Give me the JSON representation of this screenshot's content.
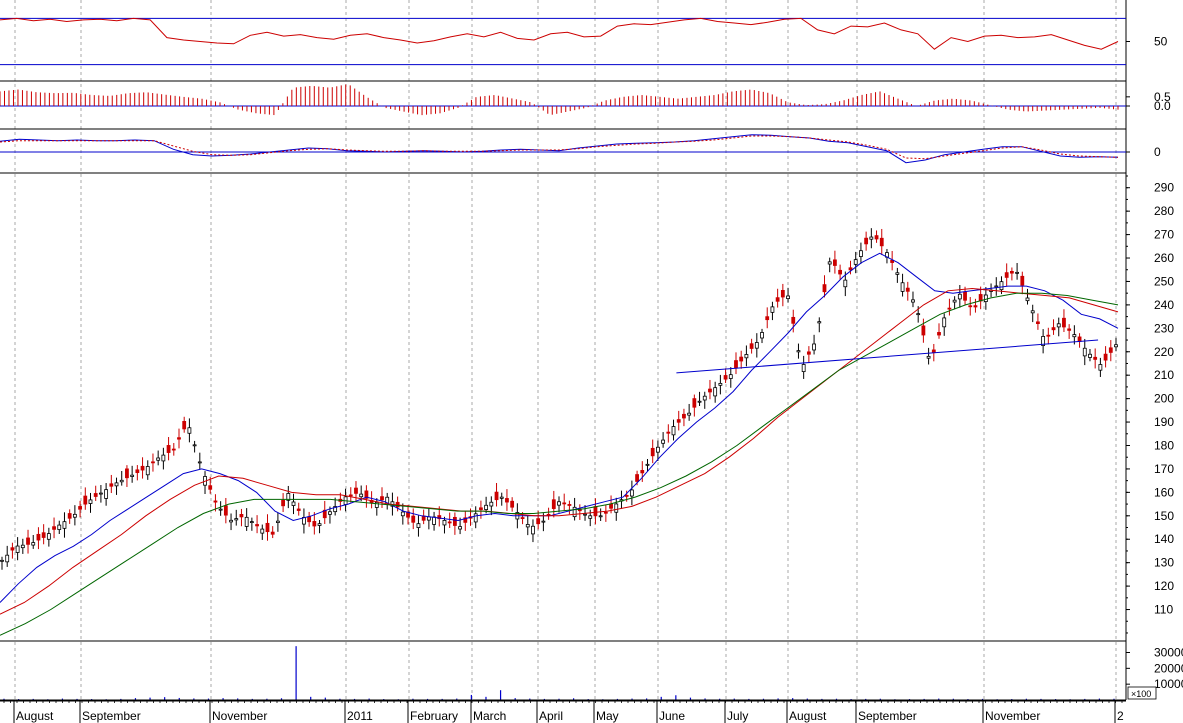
{
  "chart_data": {
    "type": "line",
    "title": "",
    "xlabel": "",
    "ylabel": "",
    "month_labels": [
      "August",
      "September",
      "November",
      "2011",
      "February",
      "March",
      "April",
      "May",
      "June",
      "July",
      "August",
      "September",
      "November",
      "2"
    ],
    "colors": {
      "price_up": "#000000",
      "price_down": "#cc0000",
      "ma_short": "#0000cc",
      "ma_mid": "#cc0000",
      "ma_long": "#006600",
      "trendline": "#0000cc",
      "rsi": "#cc0000",
      "macd_hist": "#cc0000",
      "macd": "#0000cc",
      "macd_signal": "#cc0000",
      "volume": "#0000cc",
      "grid": "#aaaaaa"
    },
    "panels": [
      {
        "id": "rsi",
        "ticks": [
          "50"
        ],
        "ylim": [
          0,
          100
        ],
        "reference_lines": [
          80,
          20
        ],
        "series": [
          {
            "values": [
              78,
              80,
              77,
              79,
              76,
              78,
              79,
              77,
              80,
              78,
              55,
              52,
              50,
              48,
              47,
              58,
              62,
              57,
              59,
              55,
              53,
              58,
              60,
              55,
              52,
              48,
              51,
              56,
              60,
              56,
              62,
              54,
              52,
              60,
              62,
              56,
              57,
              70,
              73,
              72,
              75,
              78,
              80,
              76,
              74,
              72,
              75,
              79,
              80,
              65,
              60,
              70,
              69,
              74,
              65,
              60,
              40,
              55,
              50,
              57,
              58,
              55,
              56,
              59,
              52,
              45,
              40,
              50
            ]
          }
        ]
      },
      {
        "id": "macd-histogram",
        "ticks": [
          "0.5",
          "0.0"
        ],
        "ylim": [
          -1.2,
          1.2
        ],
        "series": [
          {
            "values": [
              0.8,
              0.9,
              0.75,
              0.7,
              0.72,
              0.6,
              0.55,
              0.7,
              0.75,
              0.62,
              0.5,
              0.4,
              0.2,
              -0.2,
              -0.4,
              -0.5,
              1.0,
              1.1,
              1.0,
              1.2,
              0.5,
              -0.1,
              -0.3,
              -0.5,
              -0.4,
              -0.1,
              0.5,
              0.6,
              0.4,
              0.2,
              -0.5,
              -0.3,
              -0.1,
              0.3,
              0.5,
              0.6,
              0.5,
              0.4,
              0.5,
              0.6,
              0.8,
              0.9,
              0.7,
              0.2,
              0.05,
              0.1,
              0.3,
              0.6,
              0.8,
              0.4,
              0.0,
              0.3,
              0.4,
              0.3,
              0.05,
              -0.2,
              -0.3,
              -0.25,
              -0.2,
              -0.15,
              -0.1,
              -0.2
            ]
          }
        ]
      },
      {
        "id": "macd",
        "ticks": [
          "0"
        ],
        "ylim": [
          -3,
          3
        ],
        "series": [
          {
            "name": "macd",
            "values": [
              1.6,
              1.9,
              1.8,
              1.7,
              1.8,
              1.7,
              1.7,
              1.8,
              1.7,
              0.4,
              -0.4,
              -0.6,
              -0.5,
              -0.3,
              0.0,
              0.3,
              0.6,
              0.5,
              0.2,
              0.1,
              0.0,
              0.1,
              0.2,
              0.1,
              0.0,
              0.1,
              0.3,
              0.4,
              0.3,
              0.2,
              0.6,
              0.9,
              1.2,
              1.3,
              1.4,
              1.5,
              1.7,
              2.0,
              2.3,
              2.6,
              2.5,
              2.3,
              2.1,
              1.6,
              1.4,
              0.8,
              0.2,
              -1.6,
              -1.2,
              -0.4,
              0.0,
              0.4,
              0.8,
              0.8,
              0.1,
              -0.6,
              -0.8,
              -0.7,
              -0.8
            ]
          },
          {
            "name": "signal",
            "values": [
              1.5,
              1.7,
              1.7,
              1.7,
              1.7,
              1.7,
              1.7,
              1.7,
              1.7,
              0.9,
              0.1,
              -0.4,
              -0.5,
              -0.4,
              -0.1,
              0.2,
              0.4,
              0.5,
              0.3,
              0.2,
              0.1,
              0.1,
              0.2,
              0.1,
              0.1,
              0.1,
              0.2,
              0.3,
              0.3,
              0.3,
              0.5,
              0.8,
              1.0,
              1.2,
              1.3,
              1.5,
              1.6,
              1.8,
              2.1,
              2.4,
              2.4,
              2.3,
              2.1,
              1.8,
              1.5,
              1.0,
              0.4,
              -0.9,
              -1.0,
              -0.6,
              -0.2,
              0.2,
              0.6,
              0.8,
              0.3,
              -0.3,
              -0.6,
              -0.7,
              -0.8
            ]
          }
        ]
      },
      {
        "id": "price",
        "ticks": [
          "110",
          "120",
          "130",
          "140",
          "150",
          "160",
          "170",
          "180",
          "190",
          "200",
          "210",
          "220",
          "230",
          "240",
          "250",
          "260",
          "270",
          "280",
          "290"
        ],
        "ylim": [
          97,
          295
        ],
        "series": [
          {
            "name": "close",
            "values": [
              131,
              137,
              138,
              141,
              146,
              150,
              156,
              160,
              164,
              167,
              170,
              175,
              178,
              190,
              170,
              155,
              148,
              150,
              145,
              142,
              160,
              150,
              145,
              152,
              158,
              160,
              155,
              158,
              152,
              146,
              150,
              148,
              145,
              150,
              155,
              158,
              152,
              145,
              148,
              156,
              154,
              150,
              150,
              155,
              160,
              170,
              180,
              188,
              193,
              200,
              205,
              210,
              218,
              225,
              240,
              245,
              213,
              225,
              260,
              250,
              262,
              270,
              262,
              250,
              240,
              215,
              235,
              245,
              238,
              245,
              250,
              255,
              240,
              225,
              232,
              228,
              220,
              214,
              223
            ]
          },
          {
            "name": "ma-short",
            "values": [
              113,
              121,
              128,
              133,
              137,
              142,
              148,
              153,
              158,
              163,
              168,
              170,
              168,
              165,
              160,
              152,
              148,
              150,
              153,
              155,
              158,
              156,
              152,
              150,
              149,
              148,
              150,
              151,
              150,
              150,
              150,
              152,
              154,
              156,
              158,
              166,
              175,
              183,
              190,
              196,
              203,
              212,
              220,
              228,
              237,
              244,
              252,
              258,
              262,
              258,
              252,
              246,
              245,
              246,
              247,
              248,
              248,
              246,
              242,
              236,
              234,
              230
            ]
          },
          {
            "name": "ma-mid",
            "values": [
              108,
              113,
              120,
              128,
              135,
              142,
              150,
              157,
              163,
              167,
              166,
              163,
              160,
              159,
              159,
              157,
              155,
              154,
              153,
              152,
              152,
              151,
              150,
              150,
              151,
              152,
              154,
              158,
              163,
              168,
              175,
              183,
              192,
              200,
              208,
              216,
              224,
              232,
              240,
              246,
              247,
              246,
              245,
              244,
              243,
              240,
              237
            ]
          },
          {
            "name": "ma-long",
            "values": [
              99,
              104,
              110,
              117,
              124,
              131,
              138,
              145,
              151,
              155,
              157,
              157,
              157,
              157,
              156,
              155,
              154,
              153,
              152,
              152,
              151,
              151,
              152,
              153,
              155,
              158,
              162,
              167,
              173,
              180,
              188,
              196,
              204,
              212,
              218,
              224,
              230,
              236,
              240,
              243,
              245,
              245,
              244,
              242,
              240
            ]
          }
        ],
        "trendline": {
          "from": [
            0.605,
            211
          ],
          "to": [
            0.975,
            225
          ]
        }
      },
      {
        "id": "volume",
        "ticks": [
          "30000",
          "20000",
          "10000"
        ],
        "unit_label": "×100",
        "ylim": [
          0,
          36000
        ],
        "series": [
          {
            "values": [
              800,
              600,
              700,
              500,
              900,
              700,
              600,
              500,
              700,
              1200,
              1500,
              1800,
              1300,
              1000,
              900,
              1200,
              1000,
              700,
              800,
              1100,
              34000,
              2000,
              1500,
              800,
              700,
              900,
              600,
              500,
              800,
              700,
              700,
              900,
              3200,
              2000,
              6200,
              1200,
              900,
              700,
              800,
              1100,
              600,
              500,
              700,
              900,
              1000,
              2000,
              3000,
              1500,
              1000,
              800,
              900,
              700,
              800,
              1000,
              1200,
              900,
              700,
              800,
              600,
              700,
              800,
              500,
              600,
              700,
              900,
              800,
              600,
              700,
              500,
              600,
              800,
              700,
              600,
              500,
              700,
              900,
              800
            ]
          }
        ]
      }
    ],
    "legend": "none",
    "grid": true
  }
}
